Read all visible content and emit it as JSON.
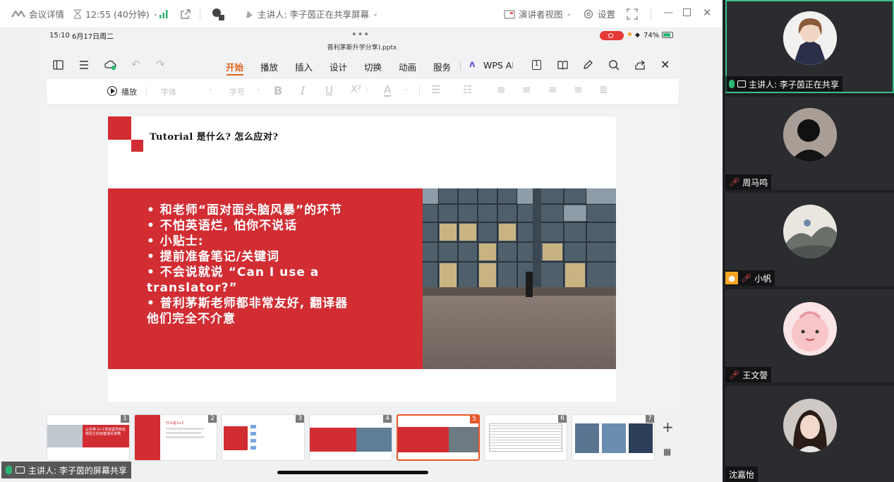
{
  "titlebar": {
    "meeting_details": "会议详情",
    "timer": "12:55 (40分钟)",
    "presenter_label": "主讲人: 李子茵正在共享屏幕",
    "speaker_view": "演讲者视图",
    "settings": "设置"
  },
  "device_status": {
    "time": "15:10",
    "date": "6月17日周二",
    "battery": "74%"
  },
  "document": {
    "filename": "普利茅斯升学分享).pptx"
  },
  "menu": {
    "items": [
      "开始",
      "播放",
      "插入",
      "设计",
      "切换",
      "动画",
      "服务"
    ],
    "wps_ai": "WPS AI",
    "active": "开始"
  },
  "format_toolbar": {
    "play": "播放",
    "font": "字体",
    "font_size": "字号"
  },
  "slide": {
    "title": "Tutorial 是什么? 怎么应对?",
    "bullets": [
      "• 和老师“面对面头脑风暴”的环节",
      "• 不怕英语烂, 怕你不说话",
      "• 小贴士:",
      "• 提前准备笔记/关键词",
      "• 不会说就说 “Can I use a",
      "translator?”",
      "• 普利茅斯老师都非常友好, 翻译器",
      "他们完全不介意"
    ],
    "accent_color": "#d12d33"
  },
  "thumbnails": [
    {
      "num": "1",
      "text": "从中英·3+1项目留学到名校硕士的双套通关攻略"
    },
    {
      "num": "2",
      "text": "什么是3+1"
    },
    {
      "num": "3",
      "text": ""
    },
    {
      "num": "4",
      "text": ""
    },
    {
      "num": "5",
      "text": ""
    },
    {
      "num": "6",
      "text": ""
    },
    {
      "num": "7",
      "text": ""
    }
  ],
  "share_label": "主讲人: 李子茵的屏幕共享",
  "participants": [
    {
      "name": "主讲人: 李子茵正在共享",
      "muted": false,
      "speaking": true
    },
    {
      "name": "周马鸣",
      "muted": true
    },
    {
      "name": "小帆",
      "muted": true
    },
    {
      "name": "王文謦",
      "muted": true
    },
    {
      "name": "沈嘉怡",
      "muted": false
    }
  ]
}
